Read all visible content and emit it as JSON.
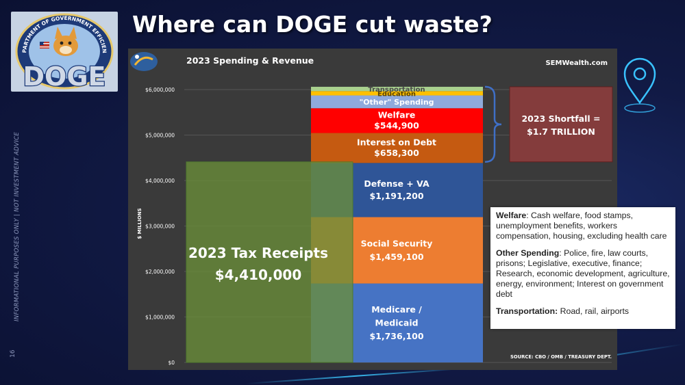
{
  "slide": {
    "title": "Where can DOGE cut waste?",
    "side_label": "INFORMATIONAL PURPOSES ONLY | NOT INVESTMENT ADVICE",
    "page_number": "16"
  },
  "logo": {
    "ring_text": "DEPARTMENT OF GOVERNMENT EFFICIENCY",
    "word": "DOGE"
  },
  "info_box": {
    "welfare_term": "Welfare",
    "welfare_text": ": Cash welfare, food stamps, unemployment benefits, workers compensation, housing, excluding health care",
    "other_term": "Other Spending",
    "other_text": ": Police, fire, law courts, prisons; Legislative, executive, finance; Research, economic development, agriculture, energy, environment; Interest on government debt",
    "transport_term": "Transportation:",
    "transport_text": " Road, rail, airports"
  },
  "chart_data": {
    "type": "bar",
    "title": "2023 Spending & Revenue",
    "brand": "SEMWealth.com",
    "source": "SOURCE: CBO / OMB / TREASURY DEPT.",
    "ylabel": "$ MILLIONS",
    "ylim": [
      0,
      6000000
    ],
    "yticks": [
      0,
      1000000,
      2000000,
      3000000,
      4000000,
      5000000,
      6000000
    ],
    "ytick_labels": [
      "$0",
      "$1,000,000",
      "$2,000,000",
      "$3,000,000",
      "$4,000,000",
      "$5,000,000",
      "$6,000,000"
    ],
    "revenue": {
      "label": "2023 Tax Receipts",
      "value_label": "$4,410,000",
      "value": 4410000,
      "color": "#6a8e3a"
    },
    "spending_stack": [
      {
        "label": "Medicare / Medicaid",
        "value_label": "$1,736,100",
        "value": 1736100,
        "color": "#4673c4"
      },
      {
        "label": "Social Security",
        "value_label": "$1,459,100",
        "value": 1459100,
        "color": "#ed7d31"
      },
      {
        "label": "Defense + VA",
        "value_label": "$1,191,200",
        "value": 1191200,
        "color": "#2f5597"
      },
      {
        "label": "Interest on Debt",
        "value_label": "$658,300",
        "value": 658300,
        "color": "#c55a11"
      },
      {
        "label": "Welfare",
        "value_label": "$544,900",
        "value": 544900,
        "color": "#ff0000"
      },
      {
        "label": "\"Other\" Spending",
        "value": 282000,
        "color": "#8faadc"
      },
      {
        "label": "Education",
        "value": 95000,
        "color": "#ffc000"
      },
      {
        "label": "Transportation",
        "value": 95000,
        "color": "#a9d18e"
      }
    ],
    "shortfall": {
      "label": "2023 Shortfall =",
      "value_label": "$1.7 TRILLION",
      "value": 1700000,
      "color": "#843c3c"
    },
    "grid": true,
    "colors": {
      "panel": "#3a3a3a",
      "gridline": "#555555",
      "tick_text": "#ffffff"
    }
  }
}
